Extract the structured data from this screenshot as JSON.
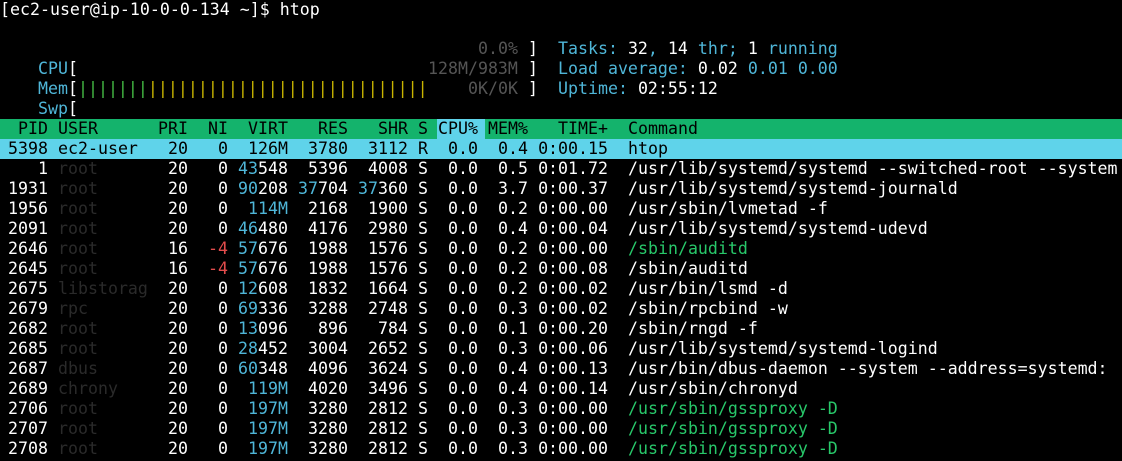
{
  "prompt": {
    "text": "[ec2-user@ip-10-0-0-134 ~]$ htop"
  },
  "meters": {
    "cpu": {
      "label": "CPU",
      "open": "[",
      "bars_green": "",
      "bars_yellow": "",
      "value": "0.0%",
      "close": "]"
    },
    "mem": {
      "label": "Mem",
      "open": "[",
      "bars_green": "|||||||",
      "bars_yellow": "||||||||||||||||||||||||||||",
      "value": "128M/983M",
      "close": "]"
    },
    "swp": {
      "label": "Swp",
      "open": "[",
      "bars_green": "",
      "bars_yellow": "",
      "value": "0K/0K",
      "close": "]"
    }
  },
  "info": {
    "tasks_label": "Tasks: ",
    "tasks_count": "32",
    "tasks_sep": ", ",
    "threads_count": "14",
    "threads_label": " thr; ",
    "running_count": "1",
    "running_label": " running",
    "load_label": "Load average: ",
    "load_1": "0.02",
    "load_5": "0.01",
    "load_15": "0.00",
    "uptime_label": "Uptime: ",
    "uptime_value": "02:55:12"
  },
  "table": {
    "headers": {
      "pid": "PID",
      "user": "USER",
      "pri": "PRI",
      "ni": "NI",
      "virt": "VIRT",
      "res": "RES",
      "shr": "SHR",
      "s": "S",
      "cpu": "CPU%",
      "mem": "MEM%",
      "time": "TIME+",
      "cmd": "Command"
    },
    "rows": [
      {
        "pid": "5398",
        "user": "ec2-user",
        "user_dim": false,
        "pri": "20",
        "ni": "0",
        "virt": "126M",
        "res": "3780",
        "shr": "3112",
        "s": "R",
        "cpu": "0.0",
        "mem": "0.4",
        "time": "0:00.15",
        "cmd": "htop",
        "cmd_green": false,
        "selected": true
      },
      {
        "pid": "1",
        "user": "root",
        "user_dim": true,
        "pri": "20",
        "ni": "0",
        "virt": "43548",
        "res": "5396",
        "shr": "4008",
        "s": "S",
        "cpu": "0.0",
        "mem": "0.5",
        "time": "0:01.72",
        "cmd": "/usr/lib/systemd/systemd --switched-root --system",
        "cmd_green": false,
        "selected": false
      },
      {
        "pid": "1931",
        "user": "root",
        "user_dim": true,
        "pri": "20",
        "ni": "0",
        "virt": "90208",
        "res": "37704",
        "shr": "37360",
        "s": "S",
        "cpu": "0.0",
        "mem": "3.7",
        "time": "0:00.37",
        "cmd": "/usr/lib/systemd/systemd-journald",
        "cmd_green": false,
        "selected": false
      },
      {
        "pid": "1956",
        "user": "root",
        "user_dim": true,
        "pri": "20",
        "ni": "0",
        "virt": "114M",
        "res": "2168",
        "shr": "1900",
        "s": "S",
        "cpu": "0.0",
        "mem": "0.2",
        "time": "0:00.00",
        "cmd": "/usr/sbin/lvmetad -f",
        "cmd_green": false,
        "selected": false
      },
      {
        "pid": "2091",
        "user": "root",
        "user_dim": true,
        "pri": "20",
        "ni": "0",
        "virt": "46480",
        "res": "4176",
        "shr": "2980",
        "s": "S",
        "cpu": "0.0",
        "mem": "0.4",
        "time": "0:00.04",
        "cmd": "/usr/lib/systemd/systemd-udevd",
        "cmd_green": false,
        "selected": false
      },
      {
        "pid": "2646",
        "user": "root",
        "user_dim": true,
        "pri": "16",
        "ni": "-4",
        "virt": "57676",
        "res": "1988",
        "shr": "1576",
        "s": "S",
        "cpu": "0.0",
        "mem": "0.2",
        "time": "0:00.00",
        "cmd": "/sbin/auditd",
        "cmd_green": true,
        "selected": false
      },
      {
        "pid": "2645",
        "user": "root",
        "user_dim": true,
        "pri": "16",
        "ni": "-4",
        "virt": "57676",
        "res": "1988",
        "shr": "1576",
        "s": "S",
        "cpu": "0.0",
        "mem": "0.2",
        "time": "0:00.08",
        "cmd": "/sbin/auditd",
        "cmd_green": false,
        "selected": false
      },
      {
        "pid": "2675",
        "user": "libstorag",
        "user_dim": true,
        "pri": "20",
        "ni": "0",
        "virt": "12608",
        "res": "1832",
        "shr": "1664",
        "s": "S",
        "cpu": "0.0",
        "mem": "0.2",
        "time": "0:00.02",
        "cmd": "/usr/bin/lsmd -d",
        "cmd_green": false,
        "selected": false
      },
      {
        "pid": "2679",
        "user": "rpc",
        "user_dim": true,
        "pri": "20",
        "ni": "0",
        "virt": "69336",
        "res": "3288",
        "shr": "2748",
        "s": "S",
        "cpu": "0.0",
        "mem": "0.3",
        "time": "0:00.02",
        "cmd": "/sbin/rpcbind -w",
        "cmd_green": false,
        "selected": false
      },
      {
        "pid": "2682",
        "user": "root",
        "user_dim": true,
        "pri": "20",
        "ni": "0",
        "virt": "13096",
        "res": "896",
        "shr": "784",
        "s": "S",
        "cpu": "0.0",
        "mem": "0.1",
        "time": "0:00.20",
        "cmd": "/sbin/rngd -f",
        "cmd_green": false,
        "selected": false
      },
      {
        "pid": "2685",
        "user": "root",
        "user_dim": true,
        "pri": "20",
        "ni": "0",
        "virt": "28452",
        "res": "3004",
        "shr": "2652",
        "s": "S",
        "cpu": "0.0",
        "mem": "0.3",
        "time": "0:00.06",
        "cmd": "/usr/lib/systemd/systemd-logind",
        "cmd_green": false,
        "selected": false
      },
      {
        "pid": "2687",
        "user": "dbus",
        "user_dim": true,
        "pri": "20",
        "ni": "0",
        "virt": "60348",
        "res": "4096",
        "shr": "3624",
        "s": "S",
        "cpu": "0.0",
        "mem": "0.4",
        "time": "0:00.13",
        "cmd": "/usr/bin/dbus-daemon --system --address=systemd:",
        "cmd_green": false,
        "selected": false
      },
      {
        "pid": "2689",
        "user": "chrony",
        "user_dim": true,
        "pri": "20",
        "ni": "0",
        "virt": "119M",
        "res": "4020",
        "shr": "3496",
        "s": "S",
        "cpu": "0.0",
        "mem": "0.4",
        "time": "0:00.14",
        "cmd": "/usr/sbin/chronyd",
        "cmd_green": false,
        "selected": false
      },
      {
        "pid": "2706",
        "user": "root",
        "user_dim": true,
        "pri": "20",
        "ni": "0",
        "virt": "197M",
        "res": "3280",
        "shr": "2812",
        "s": "S",
        "cpu": "0.0",
        "mem": "0.3",
        "time": "0:00.00",
        "cmd": "/usr/sbin/gssproxy -D",
        "cmd_green": true,
        "selected": false
      },
      {
        "pid": "2707",
        "user": "root",
        "user_dim": true,
        "pri": "20",
        "ni": "0",
        "virt": "197M",
        "res": "3280",
        "shr": "2812",
        "s": "S",
        "cpu": "0.0",
        "mem": "0.3",
        "time": "0:00.00",
        "cmd": "/usr/sbin/gssproxy -D",
        "cmd_green": true,
        "selected": false
      },
      {
        "pid": "2708",
        "user": "root",
        "user_dim": true,
        "pri": "20",
        "ni": "0",
        "virt": "197M",
        "res": "3280",
        "shr": "2812",
        "s": "S",
        "cpu": "0.0",
        "mem": "0.3",
        "time": "0:00.00",
        "cmd": "/usr/sbin/gssproxy -D",
        "cmd_green": true,
        "selected": false
      }
    ]
  },
  "colors": {
    "header_bg": "#14b36c",
    "selected_bg": "#5fd3ea",
    "meter_label": "#4fb6d8",
    "cmd_green": "#28c86a",
    "ni_negative": "#e24c4c"
  }
}
